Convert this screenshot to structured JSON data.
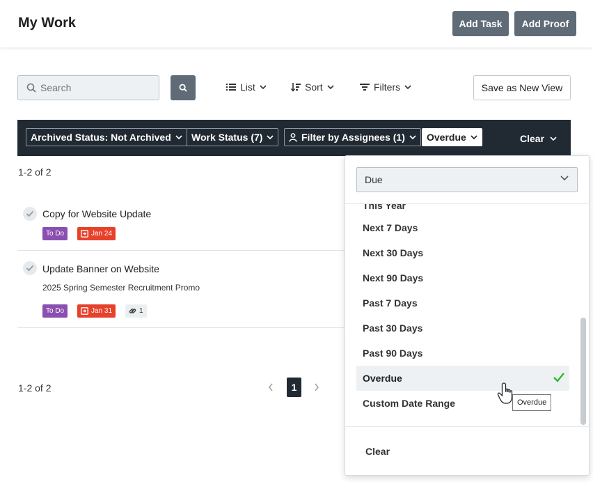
{
  "header": {
    "title": "My Work",
    "add_task": "Add Task",
    "add_proof": "Add Proof"
  },
  "toolbar": {
    "search_placeholder": "Search",
    "list_label": "List",
    "sort_label": "Sort",
    "filters_label": "Filters",
    "save_view_label": "Save as New View"
  },
  "filter_bar": {
    "chips": [
      {
        "label": "Archived Status: Not Archived"
      },
      {
        "label": "Work Status (7)"
      },
      {
        "label": "Filter by Assignees (1)"
      },
      {
        "label": "Overdue"
      }
    ],
    "clear_label": "Clear"
  },
  "results": {
    "count_top": "1-2 of 2",
    "count_bottom": "1-2 of 2",
    "current_page": "1"
  },
  "tasks": [
    {
      "title": "Copy for Website Update",
      "project": "",
      "status": "To Do",
      "due": "Jan 24"
    },
    {
      "title": "Update Banner on Website",
      "project": "2025 Spring Semester Recruitment Promo",
      "status": "To Do",
      "due": "Jan 31",
      "links": "1"
    }
  ],
  "dropdown": {
    "selected_field": "Due",
    "options": [
      {
        "label": "This Year"
      },
      {
        "label": "Next 7 Days"
      },
      {
        "label": "Next 30 Days"
      },
      {
        "label": "Next 90 Days"
      },
      {
        "label": "Past 7 Days"
      },
      {
        "label": "Past 30 Days"
      },
      {
        "label": "Past 90 Days"
      },
      {
        "label": "Overdue",
        "selected": true
      },
      {
        "label": "Custom Date Range"
      }
    ],
    "clear_label": "Clear"
  },
  "tooltip": "Overdue",
  "colors": {
    "primary_button": "#5f6b77",
    "filter_bar": "#212a33",
    "todo_badge": "#8a4fb0",
    "due_badge": "#e8412b",
    "check_mark": "#2db82d"
  }
}
